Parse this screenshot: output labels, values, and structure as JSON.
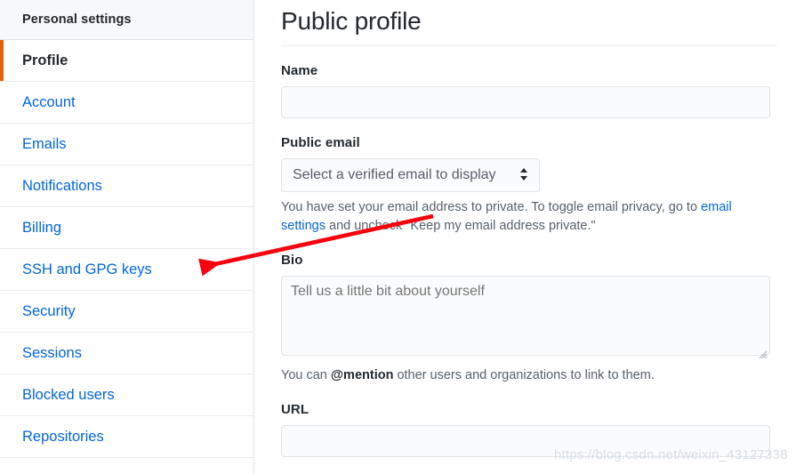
{
  "sidebar": {
    "header": "Personal settings",
    "items": [
      {
        "label": "Profile",
        "selected": true
      },
      {
        "label": "Account",
        "selected": false
      },
      {
        "label": "Emails",
        "selected": false
      },
      {
        "label": "Notifications",
        "selected": false
      },
      {
        "label": "Billing",
        "selected": false
      },
      {
        "label": "SSH and GPG keys",
        "selected": false
      },
      {
        "label": "Security",
        "selected": false
      },
      {
        "label": "Sessions",
        "selected": false
      },
      {
        "label": "Blocked users",
        "selected": false
      },
      {
        "label": "Repositories",
        "selected": false
      }
    ],
    "selected_accent_color": "#e36209",
    "link_color": "#0366d6"
  },
  "main": {
    "page_title": "Public profile",
    "name": {
      "label": "Name",
      "value": "",
      "placeholder": ""
    },
    "public_email": {
      "label": "Public email",
      "selected_option": "Select a verified email to display",
      "caret_icon": "chevron-up-down-icon",
      "help_text_before": "You have set your email address to private. To toggle email privacy, go to ",
      "help_link": "email settings",
      "help_text_after": " and uncheck \"Keep my email address private.\""
    },
    "bio": {
      "label": "Bio",
      "value": "",
      "placeholder": "Tell us a little bit about yourself",
      "help_text_before": "You can ",
      "help_bold": "@mention",
      "help_text_after": " other users and organizations to link to them."
    },
    "url": {
      "label": "URL",
      "value": "",
      "placeholder": ""
    }
  },
  "annotation": {
    "arrow_color": "#f8000d",
    "arrow_target": "sidebar-item-ssh-and-gpg-keys"
  },
  "watermark": {
    "text": "https://blog.csdn.net/weixin_43127338"
  }
}
